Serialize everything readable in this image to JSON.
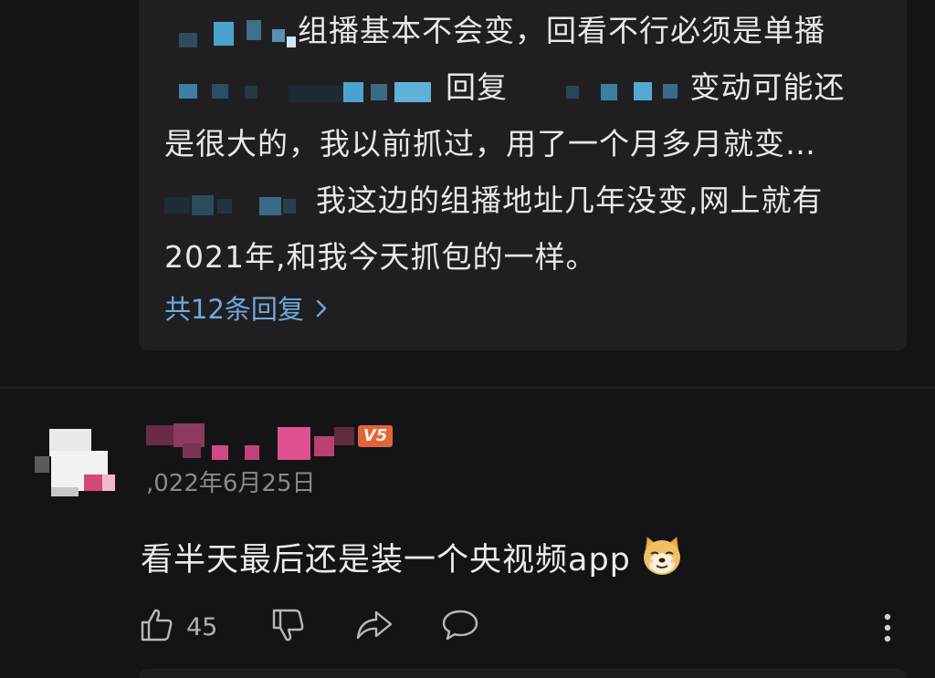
{
  "reply_preview": {
    "line1_text": "组播基本不会变，回看不行必须是单播",
    "line2_reply_word": "回复",
    "line2_text": "变动可能还",
    "line3_text": "是很大的，我以前抓过，用了一个月多月就变…",
    "line4_text": "我这边的组播地址几年没变,网上就有",
    "line5_text": "2021年,和我今天抓包的一样。",
    "more_replies_label": "共12条回复",
    "chevron_icon": "chevron-right-icon"
  },
  "comment": {
    "level_badge": "V5",
    "date": ",022年6月25日",
    "text": "看半天最后还是装一个央视频app",
    "emoji_icon": "doge-emoji-icon",
    "like_count": "45",
    "icons": {
      "like": "thumbs-up-icon",
      "dislike": "thumbs-down-icon",
      "share": "share-arrow-icon",
      "reply": "comment-bubble-icon",
      "more": "more-vertical-icon"
    }
  },
  "colors": {
    "background": "#141416",
    "card": "#1f1f22",
    "link": "#6fa8dc",
    "badge": "#e0643c",
    "muted_text": "#8a8a8e"
  }
}
